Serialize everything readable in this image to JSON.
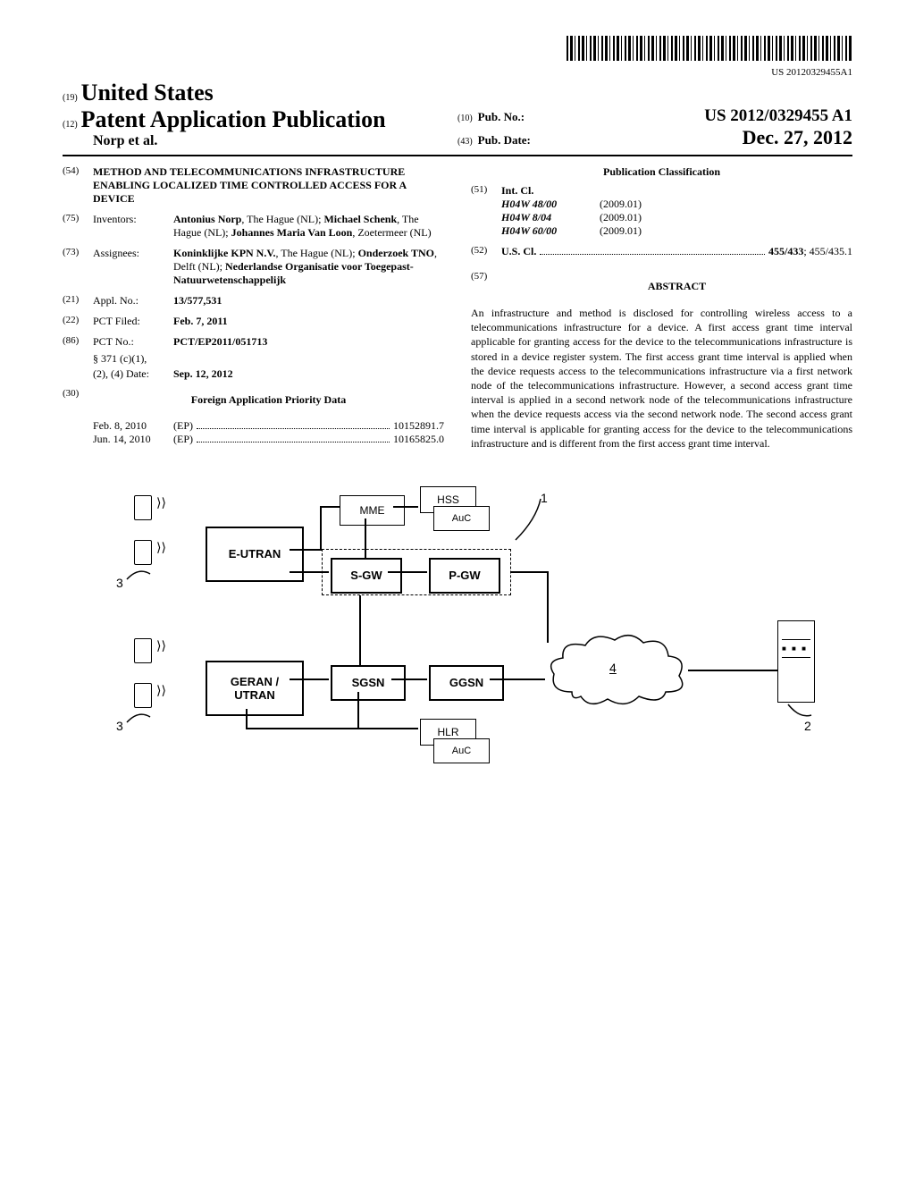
{
  "barcode_number": "US 20120329455A1",
  "header": {
    "code19": "(19)",
    "country": "United States",
    "code12": "(12)",
    "pub_type": "Patent Application Publication",
    "authors_short": "Norp et al.",
    "code10": "(10)",
    "pubno_label": "Pub. No.:",
    "pubno_value": "US 2012/0329455 A1",
    "code43": "(43)",
    "pubdate_label": "Pub. Date:",
    "pubdate_value": "Dec. 27, 2012"
  },
  "left": {
    "f54": {
      "num": "(54)",
      "title": "METHOD AND TELECOMMUNICATIONS INFRASTRUCTURE ENABLING LOCALIZED TIME CONTROLLED ACCESS FOR A DEVICE"
    },
    "f75": {
      "num": "(75)",
      "label": "Inventors:",
      "value_html": "Antonius Norp, The Hague (NL); Michael Schenk, The Hague (NL); Johannes Maria Van Loon, Zoetermeer (NL)"
    },
    "f73": {
      "num": "(73)",
      "label": "Assignees:",
      "value_html": "Koninklijke KPN N.V., The Hague (NL); Onderzoek TNO, Delft (NL); Nederlandse Organisatie voor Toegepast-Natuurwetenschappelijk"
    },
    "f21": {
      "num": "(21)",
      "label": "Appl. No.:",
      "value": "13/577,531"
    },
    "f22": {
      "num": "(22)",
      "label": "PCT Filed:",
      "value": "Feb. 7, 2011"
    },
    "f86": {
      "num": "(86)",
      "label": "PCT No.:",
      "value": "PCT/EP2011/051713",
      "sub1_label": "§ 371 (c)(1),",
      "sub2_label": "(2), (4) Date:",
      "sub2_value": "Sep. 12, 2012"
    },
    "f30": {
      "num": "(30)",
      "heading": "Foreign Application Priority Data",
      "rows": [
        {
          "date": "Feb. 8, 2010",
          "cc": "(EP)",
          "num": "10152891.7"
        },
        {
          "date": "Jun. 14, 2010",
          "cc": "(EP)",
          "num": "10165825.0"
        }
      ]
    }
  },
  "right": {
    "pubclass_heading": "Publication Classification",
    "f51": {
      "num": "(51)",
      "label": "Int. Cl.",
      "rows": [
        {
          "code": "H04W 48/00",
          "year": "(2009.01)"
        },
        {
          "code": "H04W 8/04",
          "year": "(2009.01)"
        },
        {
          "code": "H04W 60/00",
          "year": "(2009.01)"
        }
      ]
    },
    "f52": {
      "num": "(52)",
      "label": "U.S. Cl.",
      "value_bold": "455/433",
      "value_rest": "; 455/435.1"
    },
    "f57": {
      "num": "(57)",
      "heading": "ABSTRACT"
    },
    "abstract": "An infrastructure and method is disclosed for controlling wireless access to a telecommunications infrastructure for a device. A first access grant time interval applicable for granting access for the device to the telecommunications infrastructure is stored in a device register system. The first access grant time interval is applied when the device requests access to the telecommunications infrastructure via a first network node of the telecommunications infrastructure. However, a second access grant time interval is applied in a second network node of the telecommunications infrastructure when the device requests access via the second network node. The second access grant time interval is applicable for granting access for the device to the telecommunications infrastructure and is different from the first access grant time interval."
  },
  "diagram": {
    "eutran": "E-UTRAN",
    "mme": "MME",
    "hss": "HSS",
    "auc": "AuC",
    "sgw": "S-GW",
    "pgw": "P-GW",
    "geran": "GERAN / UTRAN",
    "sgsn": "SGSN",
    "ggsn": "GGSN",
    "hlr": "HLR",
    "ref1": "1",
    "ref2": "2",
    "ref3": "3",
    "ref4": "4"
  }
}
